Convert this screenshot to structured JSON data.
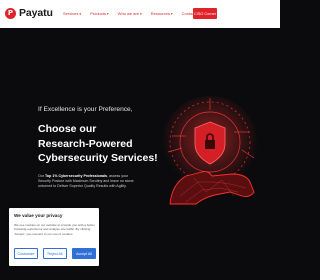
{
  "brand": {
    "name": "Payatu",
    "mark": "P",
    "accent": "#e0222b"
  },
  "nav": {
    "items": [
      {
        "label": "Services",
        "has_dropdown": true
      },
      {
        "label": "Products",
        "has_dropdown": true
      },
      {
        "label": "Who we are",
        "has_dropdown": true
      },
      {
        "label": "Resources",
        "has_dropdown": true
      },
      {
        "label": "Contact us",
        "has_dropdown": false
      }
    ],
    "cta_label": "CISO Corner"
  },
  "hero": {
    "tagline": "If Excellence is your Preference,",
    "headline_lines": [
      "Choose our",
      "Research-Powered",
      "Cybersecurity Services!"
    ],
    "desc_prefix": "Our ",
    "desc_bold": "Top 1% Cybersecurity Professionals",
    "desc_rest": ", assess your Security Posture with Maximum Scrutiny and leave no stone unturned to Deliver Superior Quality Results with Agility."
  },
  "cookie": {
    "title": "We value your privacy",
    "text": "We use cookies on our website to provide you with a better browsing experience and analyse site traffic. By clicking 'Accept', you consent to our use of cookies.",
    "customize_label": "Customize",
    "reject_label": "Reject All",
    "accept_label": "Accept All"
  }
}
